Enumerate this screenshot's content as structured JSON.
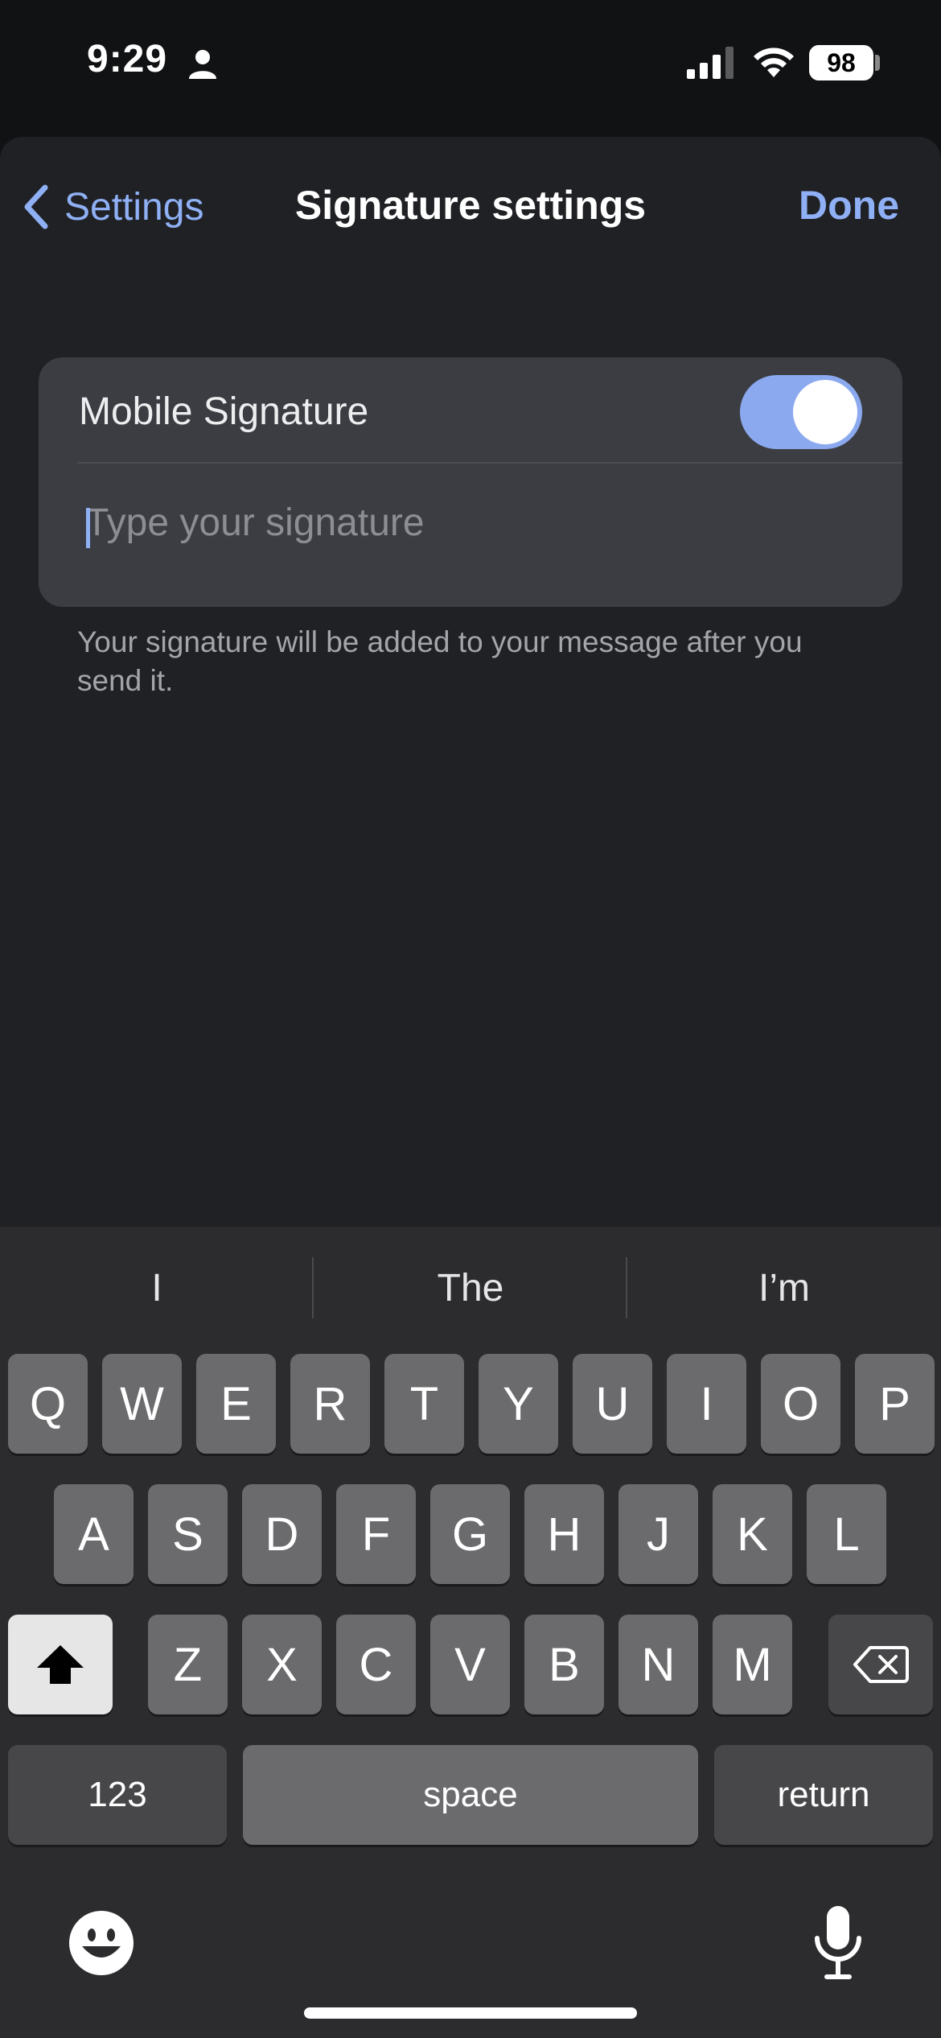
{
  "status_bar": {
    "time": "9:29",
    "battery": "98",
    "icons": [
      "person-icon",
      "signal-icon",
      "wifi-icon",
      "battery-icon"
    ]
  },
  "nav": {
    "back_label": "Settings",
    "title": "Signature settings",
    "done_label": "Done"
  },
  "signature_card": {
    "label": "Mobile Signature",
    "toggle_on": true,
    "input_value": "",
    "input_placeholder": "Type your signature"
  },
  "helper_text": "Your signature will be added to your message after you send it.",
  "keyboard": {
    "suggestions": [
      "I",
      "The",
      "I’m"
    ],
    "row1": [
      "Q",
      "W",
      "E",
      "R",
      "T",
      "Y",
      "U",
      "I",
      "O",
      "P"
    ],
    "row2": [
      "A",
      "S",
      "D",
      "F",
      "G",
      "H",
      "J",
      "K",
      "L"
    ],
    "row3": [
      "Z",
      "X",
      "C",
      "V",
      "B",
      "N",
      "M"
    ],
    "numbers_label": "123",
    "space_label": "space",
    "return_label": "return"
  },
  "colors": {
    "accent": "#8fb0f5",
    "toggle_on": "#8ba9ee",
    "sheet_bg": "#202125",
    "card_bg": "#3b3d42"
  }
}
